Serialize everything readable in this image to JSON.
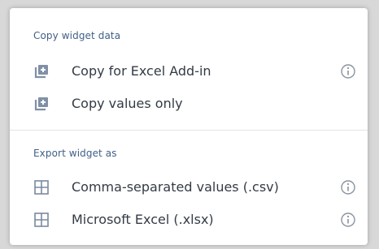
{
  "copy_section": {
    "title": "Copy widget data",
    "items": [
      {
        "label": "Copy for Excel Add-in",
        "icon": "copy-add-icon",
        "has_info": true
      },
      {
        "label": "Copy values only",
        "icon": "copy-add-icon",
        "has_info": false
      }
    ]
  },
  "export_section": {
    "title": "Export widget as",
    "items": [
      {
        "label": "Comma-separated values (.csv)",
        "icon": "grid-icon",
        "has_info": true
      },
      {
        "label": "Microsoft Excel (.xlsx)",
        "icon": "grid-icon",
        "has_info": true
      }
    ]
  },
  "colors": {
    "section_title": "#3f5f86",
    "item_text": "#333b45",
    "icon": "#7a8aa0",
    "divider": "#e4e4e4"
  }
}
